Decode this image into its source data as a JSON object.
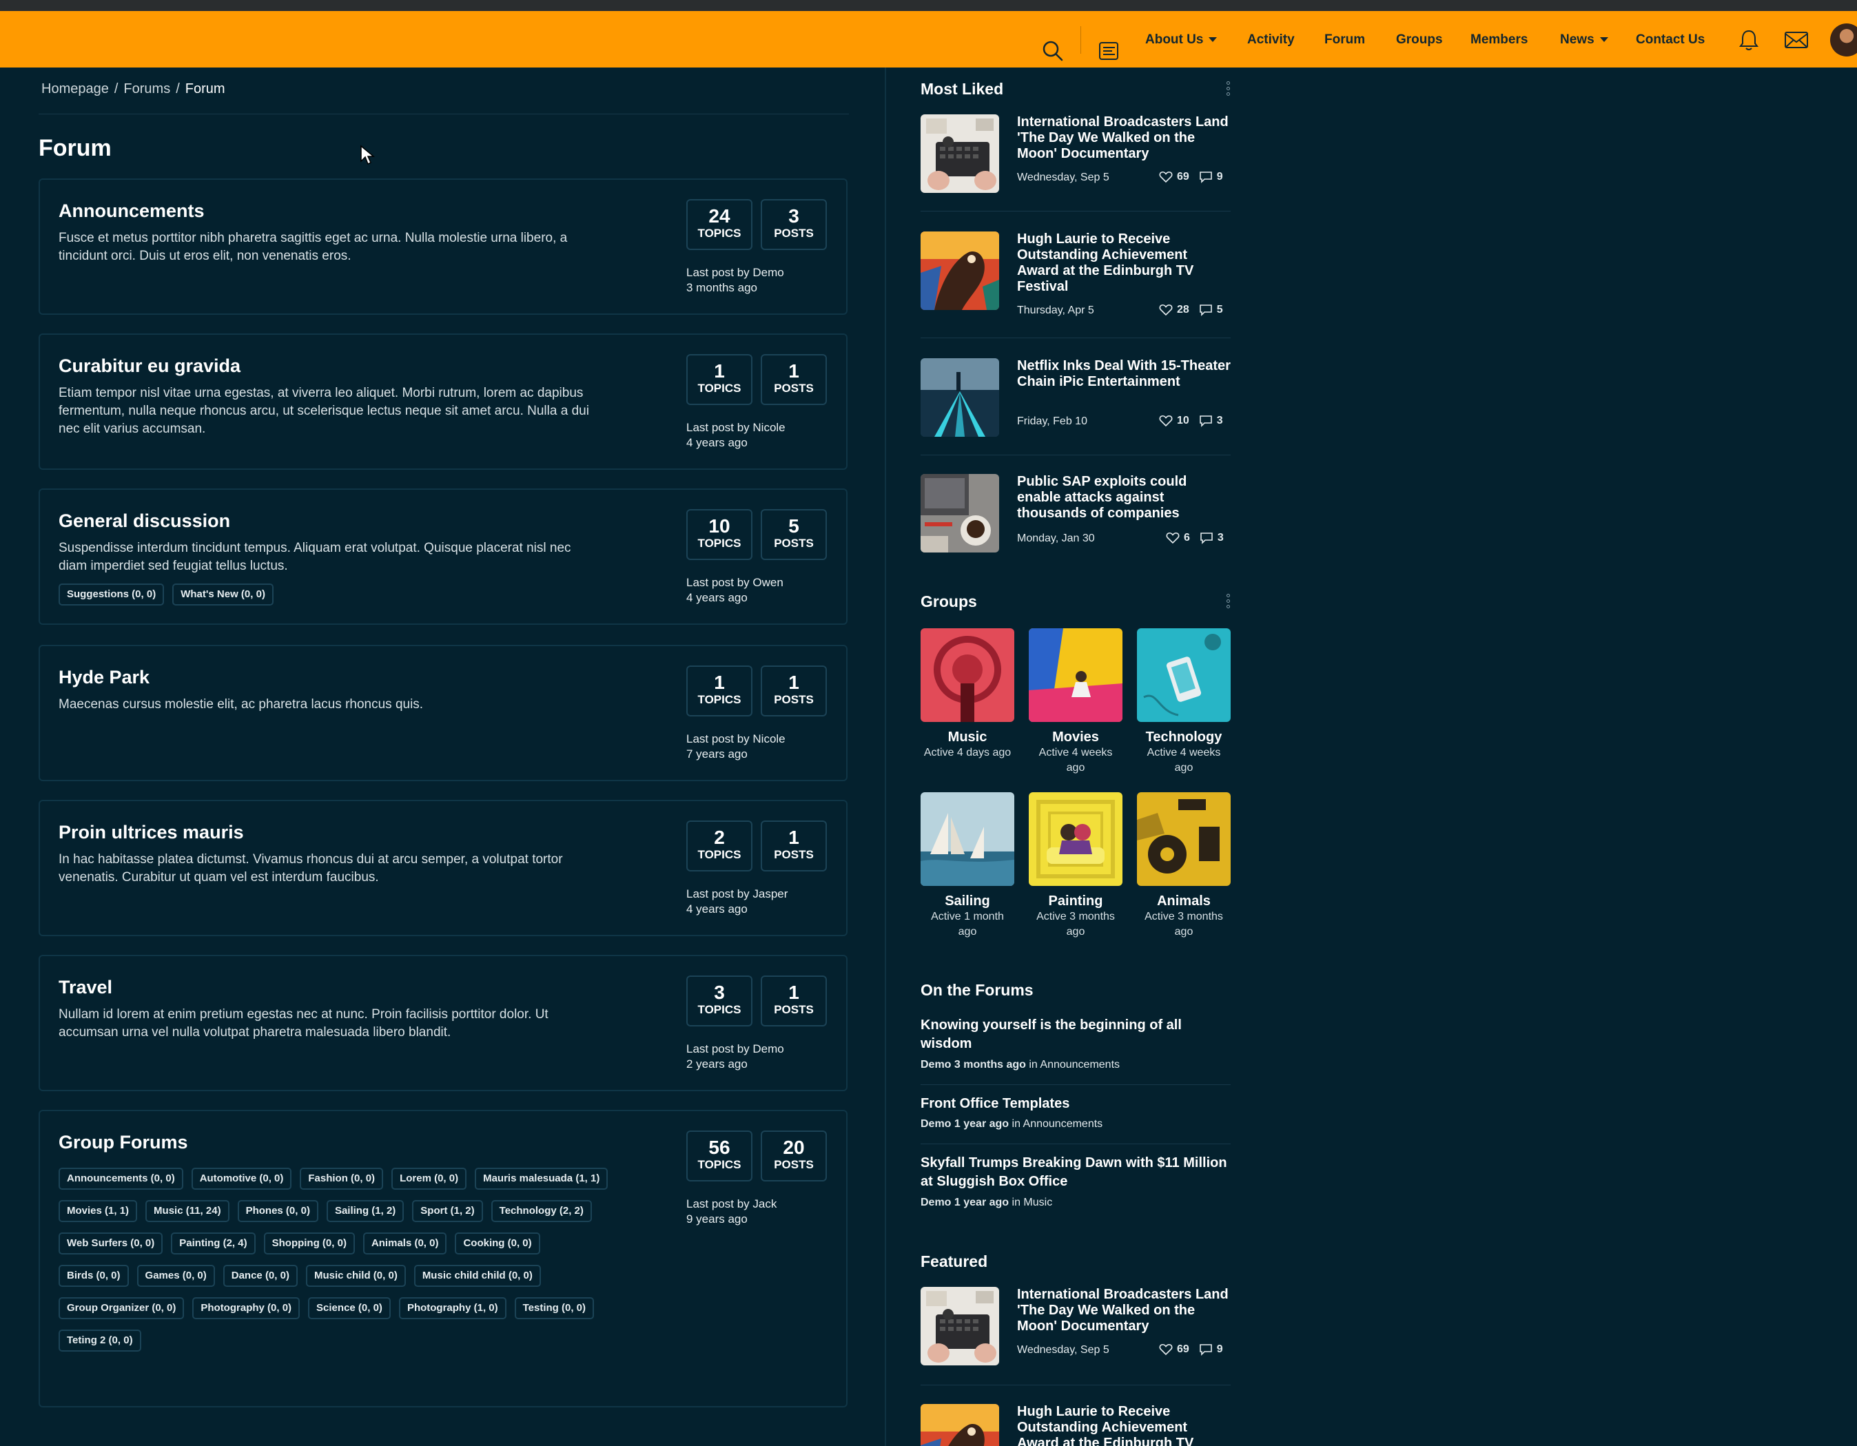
{
  "nav": {
    "items": [
      {
        "label": "About Us",
        "dropdown": true
      },
      {
        "label": "Activity"
      },
      {
        "label": "Forum"
      },
      {
        "label": "Groups"
      },
      {
        "label": "Members"
      },
      {
        "label": "News",
        "dropdown": true
      },
      {
        "label": "Contact Us"
      }
    ],
    "icons": [
      "search-icon",
      "menu-lines-icon",
      "bell-icon",
      "envelope-icon",
      "avatar"
    ],
    "accent": "#ff9a00"
  },
  "breadcrumb": {
    "items": [
      "Homepage",
      "Forums",
      "Forum"
    ],
    "separator": "/"
  },
  "page_title": "Forum",
  "forums": [
    {
      "title": "Announcements",
      "desc": "Fusce et metus porttitor nibh pharetra sagittis eget ac urna. Nulla molestie urna libero, a tincidunt orci. Duis ut eros elit, non venenatis eros.",
      "topics": "24",
      "topics_label": "TOPICS",
      "posts": "3",
      "posts_label": "POSTS",
      "last_by": "Last post by Demo",
      "last_when": "3 months ago",
      "tags": []
    },
    {
      "title": "Curabitur eu gravida",
      "desc": "Etiam tempor nisl vitae urna egestas, at viverra leo aliquet. Morbi rutrum, lorem ac dapibus fermentum, nulla neque rhoncus arcu, ut scelerisque lectus neque sit amet arcu. Nulla a dui nec elit varius accumsan.",
      "topics": "1",
      "topics_label": "TOPICS",
      "posts": "1",
      "posts_label": "POSTS",
      "last_by": "Last post by Nicole",
      "last_when": "4 years ago",
      "tags": []
    },
    {
      "title": "General discussion",
      "desc": "Suspendisse interdum tincidunt tempus. Aliquam erat volutpat. Quisque placerat nisl nec diam imperdiet sed feugiat tellus luctus.",
      "topics": "10",
      "topics_label": "TOPICS",
      "posts": "5",
      "posts_label": "POSTS",
      "last_by": "Last post by Owen",
      "last_when": "4 years ago",
      "tags": [
        "Suggestions (0, 0)",
        "What's New (0, 0)"
      ]
    },
    {
      "title": "Hyde Park",
      "desc": "Maecenas cursus molestie elit, ac pharetra lacus rhoncus quis.",
      "topics": "1",
      "topics_label": "TOPICS",
      "posts": "1",
      "posts_label": "POSTS",
      "last_by": "Last post by Nicole",
      "last_when": "7 years ago",
      "tags": []
    },
    {
      "title": "Proin ultrices mauris",
      "desc": "In hac habitasse platea dictumst. Vivamus rhoncus dui at arcu semper, a volutpat tortor venenatis. Curabitur ut quam vel est interdum faucibus.",
      "topics": "2",
      "topics_label": "TOPICS",
      "posts": "1",
      "posts_label": "POSTS",
      "last_by": "Last post by Jasper",
      "last_when": "4 years ago",
      "tags": []
    },
    {
      "title": "Travel",
      "desc": "Nullam id lorem at enim pretium egestas nec at nunc. Proin facilisis porttitor dolor. Ut accumsan urna vel nulla volutpat pharetra malesuada libero blandit.",
      "topics": "3",
      "topics_label": "TOPICS",
      "posts": "1",
      "posts_label": "POSTS",
      "last_by": "Last post by Demo",
      "last_when": "2 years ago",
      "tags": []
    },
    {
      "title": "Group Forums",
      "desc": "",
      "topics": "56",
      "topics_label": "TOPICS",
      "posts": "20",
      "posts_label": "POSTS",
      "last_by": "Last post by Jack",
      "last_when": "9 years ago",
      "tags": [
        "Announcements (0, 0)",
        "Automotive (0, 0)",
        "Fashion (0, 0)",
        "Lorem (0, 0)",
        "Mauris malesuada (1, 1)",
        "Movies (1, 1)",
        "Music (11, 24)",
        "Phones (0, 0)",
        "Sailing (1, 2)",
        "Sport (1, 2)",
        "Technology (2, 2)",
        "Web Surfers (0, 0)",
        "Painting (2, 4)",
        "Shopping (0, 0)",
        "Animals (0, 0)",
        "Cooking (0, 0)",
        "Birds (0, 0)",
        "Games (0, 0)",
        "Dance (0, 0)",
        "Music child (0, 0)",
        "Music child child (0, 0)",
        "Group Organizer (0, 0)",
        "Photography (0, 0)",
        "Science (0, 0)",
        "Photography (1, 0)",
        "Testing (0, 0)",
        "Teting 2 (0, 0)"
      ]
    }
  ],
  "sidebar": {
    "most_liked": {
      "title": "Most Liked",
      "posts": [
        {
          "title": "International Broadcasters Land 'The Day We Walked on the Moon' Documentary",
          "date": "Wednesday, Sep 5",
          "likes": "69",
          "comments": "9"
        },
        {
          "title": "Hugh Laurie to Receive Outstanding Achievement Award at the Edinburgh TV Festival",
          "date": "Thursday, Apr 5",
          "likes": "28",
          "comments": "5"
        },
        {
          "title": "Netflix Inks Deal With 15-Theater Chain iPic Entertainment",
          "date": "Friday, Feb 10",
          "likes": "10",
          "comments": "3"
        },
        {
          "title": "Public SAP exploits could enable attacks against thousands of companies",
          "date": "Monday, Jan 30",
          "likes": "6",
          "comments": "3"
        }
      ]
    },
    "groups": {
      "title": "Groups",
      "items": [
        {
          "name": "Music",
          "active": "Active 4 days ago"
        },
        {
          "name": "Movies",
          "active": "Active 4 weeks ago"
        },
        {
          "name": "Technology",
          "active": "Active 4 weeks ago"
        },
        {
          "name": "Sailing",
          "active": "Active 1 month ago"
        },
        {
          "name": "Painting",
          "active": "Active 3 months ago"
        },
        {
          "name": "Animals",
          "active": "Active 3 months ago"
        }
      ]
    },
    "on_forums": {
      "title": "On the Forums",
      "items": [
        {
          "title": "Knowing yourself is the beginning of all wisdom",
          "author": "Demo",
          "when": "3 months ago",
          "in": "in",
          "forum": "Announcements"
        },
        {
          "title": "Front Office Templates",
          "author": "Demo",
          "when": "1 year ago",
          "in": "in",
          "forum": "Announcements"
        },
        {
          "title": "Skyfall Trumps Breaking Dawn with $11 Million at Sluggish Box Office",
          "author": "Demo",
          "when": "1 year ago",
          "in": "in",
          "forum": "Music"
        }
      ]
    },
    "featured": {
      "title": "Featured",
      "posts": [
        {
          "title": "International Broadcasters Land 'The Day We Walked on the Moon' Documentary",
          "date": "Wednesday, Sep 5",
          "likes": "69",
          "comments": "9"
        },
        {
          "title": "Hugh Laurie to Receive Outstanding Achievement Award at the Edinburgh TV Festival",
          "date": "",
          "likes": "",
          "comments": ""
        }
      ]
    }
  }
}
